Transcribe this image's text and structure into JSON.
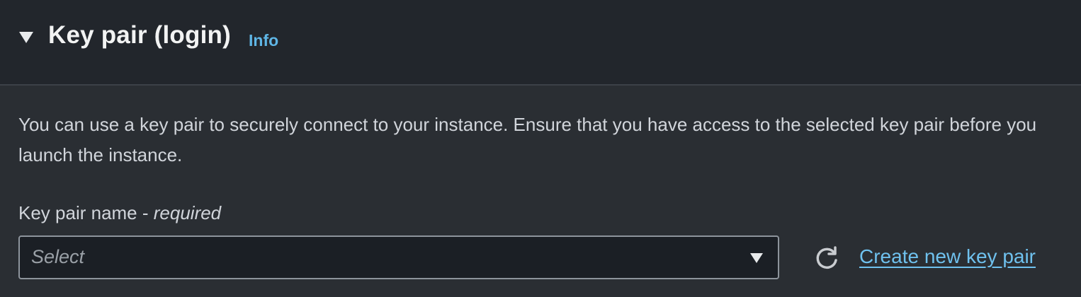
{
  "header": {
    "title": "Key pair (login)",
    "info_label": "Info",
    "expanded": true
  },
  "body": {
    "description": "You can use a key pair to securely connect to your instance. Ensure that you have access to the selected key pair before you launch the instance.",
    "field": {
      "label": "Key pair name - ",
      "required_text": "required",
      "placeholder": "Select",
      "value": ""
    },
    "refresh_icon": "refresh-icon",
    "create_link_label": "Create new key pair"
  },
  "colors": {
    "header_bg": "#22262c",
    "body_bg": "#2a2e33",
    "link": "#5fb6e6",
    "input_bg": "#1b1f25",
    "input_border": "#8d949c"
  }
}
